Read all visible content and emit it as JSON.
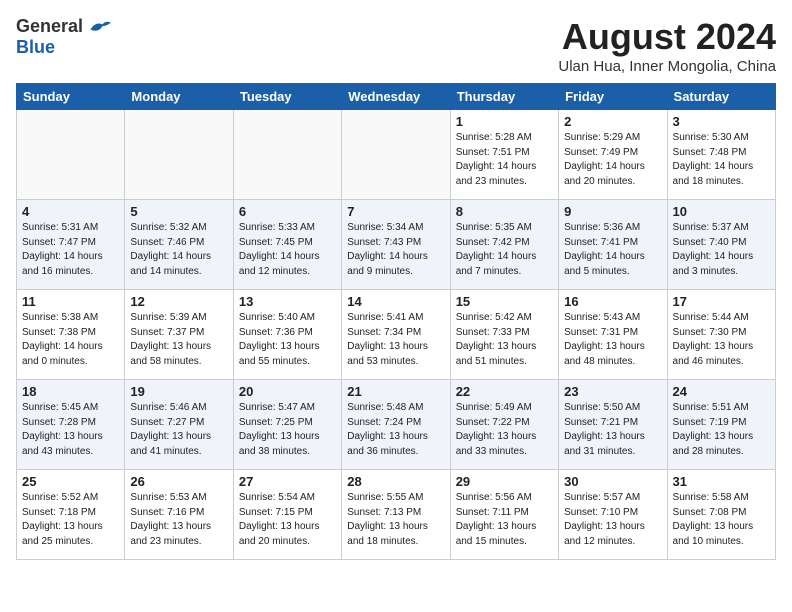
{
  "header": {
    "logo_general": "General",
    "logo_blue": "Blue",
    "title": "August 2024",
    "location": "Ulan Hua, Inner Mongolia, China"
  },
  "days_of_week": [
    "Sunday",
    "Monday",
    "Tuesday",
    "Wednesday",
    "Thursday",
    "Friday",
    "Saturday"
  ],
  "weeks": [
    [
      {
        "day": "",
        "sunrise": "",
        "sunset": "",
        "daylight": "",
        "empty": true
      },
      {
        "day": "",
        "sunrise": "",
        "sunset": "",
        "daylight": "",
        "empty": true
      },
      {
        "day": "",
        "sunrise": "",
        "sunset": "",
        "daylight": "",
        "empty": true
      },
      {
        "day": "",
        "sunrise": "",
        "sunset": "",
        "daylight": "",
        "empty": true
      },
      {
        "day": "1",
        "sunrise": "Sunrise: 5:28 AM",
        "sunset": "Sunset: 7:51 PM",
        "daylight": "Daylight: 14 hours and 23 minutes.",
        "empty": false
      },
      {
        "day": "2",
        "sunrise": "Sunrise: 5:29 AM",
        "sunset": "Sunset: 7:49 PM",
        "daylight": "Daylight: 14 hours and 20 minutes.",
        "empty": false
      },
      {
        "day": "3",
        "sunrise": "Sunrise: 5:30 AM",
        "sunset": "Sunset: 7:48 PM",
        "daylight": "Daylight: 14 hours and 18 minutes.",
        "empty": false
      }
    ],
    [
      {
        "day": "4",
        "sunrise": "Sunrise: 5:31 AM",
        "sunset": "Sunset: 7:47 PM",
        "daylight": "Daylight: 14 hours and 16 minutes.",
        "empty": false
      },
      {
        "day": "5",
        "sunrise": "Sunrise: 5:32 AM",
        "sunset": "Sunset: 7:46 PM",
        "daylight": "Daylight: 14 hours and 14 minutes.",
        "empty": false
      },
      {
        "day": "6",
        "sunrise": "Sunrise: 5:33 AM",
        "sunset": "Sunset: 7:45 PM",
        "daylight": "Daylight: 14 hours and 12 minutes.",
        "empty": false
      },
      {
        "day": "7",
        "sunrise": "Sunrise: 5:34 AM",
        "sunset": "Sunset: 7:43 PM",
        "daylight": "Daylight: 14 hours and 9 minutes.",
        "empty": false
      },
      {
        "day": "8",
        "sunrise": "Sunrise: 5:35 AM",
        "sunset": "Sunset: 7:42 PM",
        "daylight": "Daylight: 14 hours and 7 minutes.",
        "empty": false
      },
      {
        "day": "9",
        "sunrise": "Sunrise: 5:36 AM",
        "sunset": "Sunset: 7:41 PM",
        "daylight": "Daylight: 14 hours and 5 minutes.",
        "empty": false
      },
      {
        "day": "10",
        "sunrise": "Sunrise: 5:37 AM",
        "sunset": "Sunset: 7:40 PM",
        "daylight": "Daylight: 14 hours and 3 minutes.",
        "empty": false
      }
    ],
    [
      {
        "day": "11",
        "sunrise": "Sunrise: 5:38 AM",
        "sunset": "Sunset: 7:38 PM",
        "daylight": "Daylight: 14 hours and 0 minutes.",
        "empty": false
      },
      {
        "day": "12",
        "sunrise": "Sunrise: 5:39 AM",
        "sunset": "Sunset: 7:37 PM",
        "daylight": "Daylight: 13 hours and 58 minutes.",
        "empty": false
      },
      {
        "day": "13",
        "sunrise": "Sunrise: 5:40 AM",
        "sunset": "Sunset: 7:36 PM",
        "daylight": "Daylight: 13 hours and 55 minutes.",
        "empty": false
      },
      {
        "day": "14",
        "sunrise": "Sunrise: 5:41 AM",
        "sunset": "Sunset: 7:34 PM",
        "daylight": "Daylight: 13 hours and 53 minutes.",
        "empty": false
      },
      {
        "day": "15",
        "sunrise": "Sunrise: 5:42 AM",
        "sunset": "Sunset: 7:33 PM",
        "daylight": "Daylight: 13 hours and 51 minutes.",
        "empty": false
      },
      {
        "day": "16",
        "sunrise": "Sunrise: 5:43 AM",
        "sunset": "Sunset: 7:31 PM",
        "daylight": "Daylight: 13 hours and 48 minutes.",
        "empty": false
      },
      {
        "day": "17",
        "sunrise": "Sunrise: 5:44 AM",
        "sunset": "Sunset: 7:30 PM",
        "daylight": "Daylight: 13 hours and 46 minutes.",
        "empty": false
      }
    ],
    [
      {
        "day": "18",
        "sunrise": "Sunrise: 5:45 AM",
        "sunset": "Sunset: 7:28 PM",
        "daylight": "Daylight: 13 hours and 43 minutes.",
        "empty": false
      },
      {
        "day": "19",
        "sunrise": "Sunrise: 5:46 AM",
        "sunset": "Sunset: 7:27 PM",
        "daylight": "Daylight: 13 hours and 41 minutes.",
        "empty": false
      },
      {
        "day": "20",
        "sunrise": "Sunrise: 5:47 AM",
        "sunset": "Sunset: 7:25 PM",
        "daylight": "Daylight: 13 hours and 38 minutes.",
        "empty": false
      },
      {
        "day": "21",
        "sunrise": "Sunrise: 5:48 AM",
        "sunset": "Sunset: 7:24 PM",
        "daylight": "Daylight: 13 hours and 36 minutes.",
        "empty": false
      },
      {
        "day": "22",
        "sunrise": "Sunrise: 5:49 AM",
        "sunset": "Sunset: 7:22 PM",
        "daylight": "Daylight: 13 hours and 33 minutes.",
        "empty": false
      },
      {
        "day": "23",
        "sunrise": "Sunrise: 5:50 AM",
        "sunset": "Sunset: 7:21 PM",
        "daylight": "Daylight: 13 hours and 31 minutes.",
        "empty": false
      },
      {
        "day": "24",
        "sunrise": "Sunrise: 5:51 AM",
        "sunset": "Sunset: 7:19 PM",
        "daylight": "Daylight: 13 hours and 28 minutes.",
        "empty": false
      }
    ],
    [
      {
        "day": "25",
        "sunrise": "Sunrise: 5:52 AM",
        "sunset": "Sunset: 7:18 PM",
        "daylight": "Daylight: 13 hours and 25 minutes.",
        "empty": false
      },
      {
        "day": "26",
        "sunrise": "Sunrise: 5:53 AM",
        "sunset": "Sunset: 7:16 PM",
        "daylight": "Daylight: 13 hours and 23 minutes.",
        "empty": false
      },
      {
        "day": "27",
        "sunrise": "Sunrise: 5:54 AM",
        "sunset": "Sunset: 7:15 PM",
        "daylight": "Daylight: 13 hours and 20 minutes.",
        "empty": false
      },
      {
        "day": "28",
        "sunrise": "Sunrise: 5:55 AM",
        "sunset": "Sunset: 7:13 PM",
        "daylight": "Daylight: 13 hours and 18 minutes.",
        "empty": false
      },
      {
        "day": "29",
        "sunrise": "Sunrise: 5:56 AM",
        "sunset": "Sunset: 7:11 PM",
        "daylight": "Daylight: 13 hours and 15 minutes.",
        "empty": false
      },
      {
        "day": "30",
        "sunrise": "Sunrise: 5:57 AM",
        "sunset": "Sunset: 7:10 PM",
        "daylight": "Daylight: 13 hours and 12 minutes.",
        "empty": false
      },
      {
        "day": "31",
        "sunrise": "Sunrise: 5:58 AM",
        "sunset": "Sunset: 7:08 PM",
        "daylight": "Daylight: 13 hours and 10 minutes.",
        "empty": false
      }
    ]
  ]
}
